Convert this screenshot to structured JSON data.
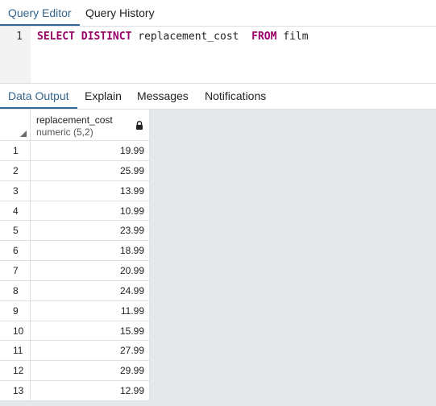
{
  "top_tabs": [
    {
      "label": "Query Editor",
      "active": true
    },
    {
      "label": "Query History",
      "active": false
    }
  ],
  "editor": {
    "line_number": "1",
    "tokens": {
      "kw_select": "SELECT",
      "kw_distinct": "DISTINCT",
      "column": "replacement_cost",
      "kw_from": "FROM",
      "table": "film"
    }
  },
  "result_tabs": [
    {
      "label": "Data Output",
      "active": true
    },
    {
      "label": "Explain",
      "active": false
    },
    {
      "label": "Messages",
      "active": false
    },
    {
      "label": "Notifications",
      "active": false
    }
  ],
  "grid": {
    "column": {
      "name": "replacement_cost",
      "type": "numeric (5,2)"
    },
    "rows": [
      {
        "num": "1",
        "value": "19.99"
      },
      {
        "num": "2",
        "value": "25.99"
      },
      {
        "num": "3",
        "value": "13.99"
      },
      {
        "num": "4",
        "value": "10.99"
      },
      {
        "num": "5",
        "value": "23.99"
      },
      {
        "num": "6",
        "value": "18.99"
      },
      {
        "num": "7",
        "value": "20.99"
      },
      {
        "num": "8",
        "value": "24.99"
      },
      {
        "num": "9",
        "value": "11.99"
      },
      {
        "num": "10",
        "value": "15.99"
      },
      {
        "num": "11",
        "value": "27.99"
      },
      {
        "num": "12",
        "value": "29.99"
      },
      {
        "num": "13",
        "value": "12.99"
      }
    ]
  },
  "colors": {
    "accent": "#326690",
    "keyword": "#990066",
    "grid_bg": "#e6e8ec"
  },
  "icons": {
    "sort_corner": "triangle-corner-icon",
    "column_lock": "lock-icon"
  }
}
